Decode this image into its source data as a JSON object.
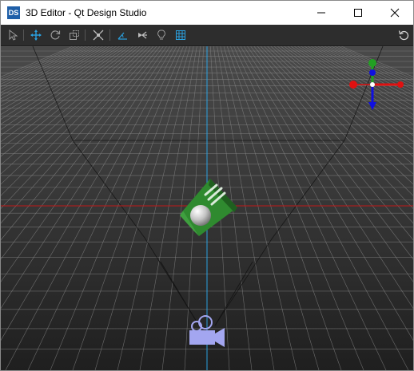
{
  "window": {
    "app_badge": "DS",
    "title": "3D Editor - Qt Design Studio"
  },
  "window_controls": [
    "minimize",
    "maximize",
    "close"
  ],
  "toolbar": {
    "tools": [
      {
        "name": "select-tool",
        "icon": "cursor-arrow-icon",
        "active": false
      },
      {
        "name": "move-tool",
        "icon": "move-arrows-icon",
        "active": true
      },
      {
        "name": "rotate-tool",
        "icon": "rotate-icon",
        "active": false
      },
      {
        "name": "scale-tool",
        "icon": "scale-icon",
        "active": false
      },
      {
        "name": "fit-to-view",
        "icon": "fit-view-icon",
        "active": false
      },
      {
        "name": "toggle-edit-orientation",
        "icon": "orientation-icon",
        "active": false
      },
      {
        "name": "toggle-camera-view",
        "icon": "camera-toggle-icon",
        "active": false
      },
      {
        "name": "toggle-light",
        "icon": "light-bulb-icon",
        "active": false
      },
      {
        "name": "toggle-grid",
        "icon": "grid-icon",
        "active": false
      },
      {
        "name": "reset-view",
        "icon": "reset-icon",
        "active": false
      }
    ]
  },
  "colors": {
    "accent": "#2aa1e0",
    "viewport_bg": "#2b2b2b",
    "toolbar_bg": "#2d2d2d",
    "axis_x": "#e01010",
    "axis_y": "#22a022",
    "axis_z": "#1010e0",
    "model_green": "#2f8a2f",
    "camera_gizmo": "#a3a6f0"
  },
  "scene": {
    "objects": [
      "cube-model",
      "sphere-model",
      "camera-gizmo",
      "axis-helper"
    ]
  }
}
